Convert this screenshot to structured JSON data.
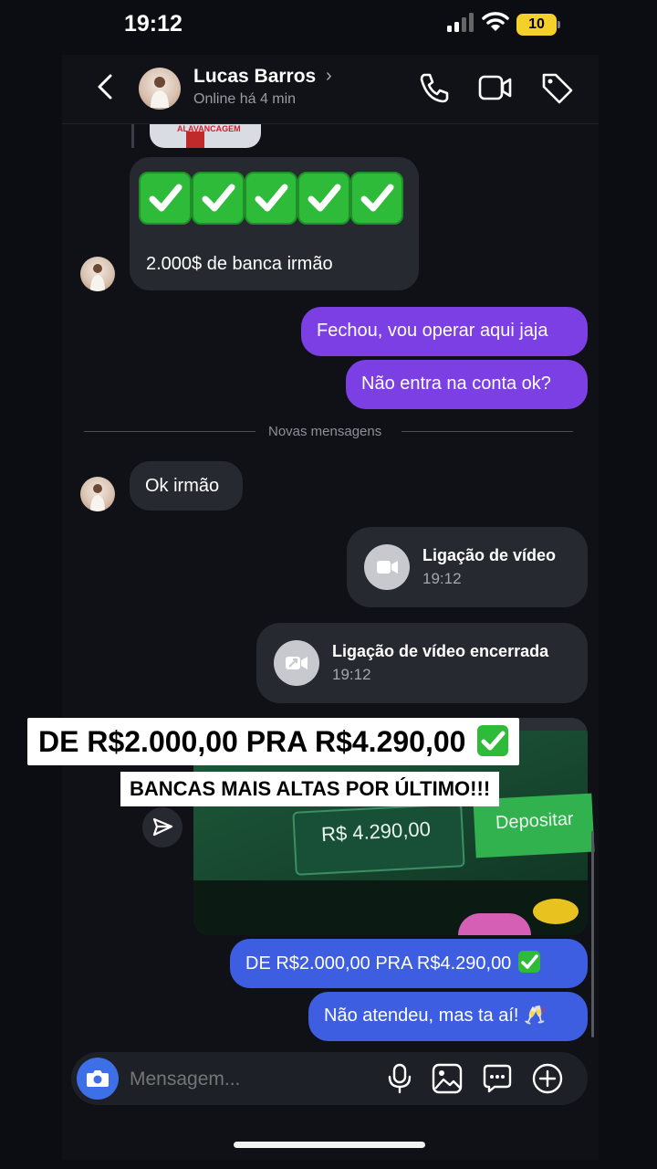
{
  "status_bar": {
    "time": "19:12",
    "battery": "10"
  },
  "header": {
    "name": "Lucas Barros",
    "status": "Online há 4 min"
  },
  "messages": {
    "incoming_check_text": "2.000$ de banca irmão",
    "out_1": "Fechou, vou operar aqui jaja",
    "out_2": "Não entra na conta ok?",
    "divider": "Novas mensagens",
    "incoming_2": "Ok irmão",
    "call_1_title": "Ligação de vídeo",
    "call_1_time": "19:12",
    "call_2_title": "Ligação de vídeo encerrada",
    "call_2_time": "19:12",
    "out_3": "DE R$2.000,00 PRA R$4.290,00",
    "out_4": "Não atendeu, mas ta aí! 🥂"
  },
  "image_message": {
    "balance": "R$ 4.290,00",
    "deposit_label": "Depositar",
    "thumb_banner": "ALAVANCAGEM"
  },
  "overlay": {
    "caption_1": "DE R$2.000,00 PRA R$4.290,00",
    "caption_2": "BANCAS MAIS ALTAS POR ÚLTIMO!!!"
  },
  "composer": {
    "placeholder": "Mensagem..."
  },
  "colors": {
    "outgoing_purple": "#7b3fe4",
    "outgoing_blue": "#3d5ee0",
    "check_green": "#2fbb3a"
  }
}
